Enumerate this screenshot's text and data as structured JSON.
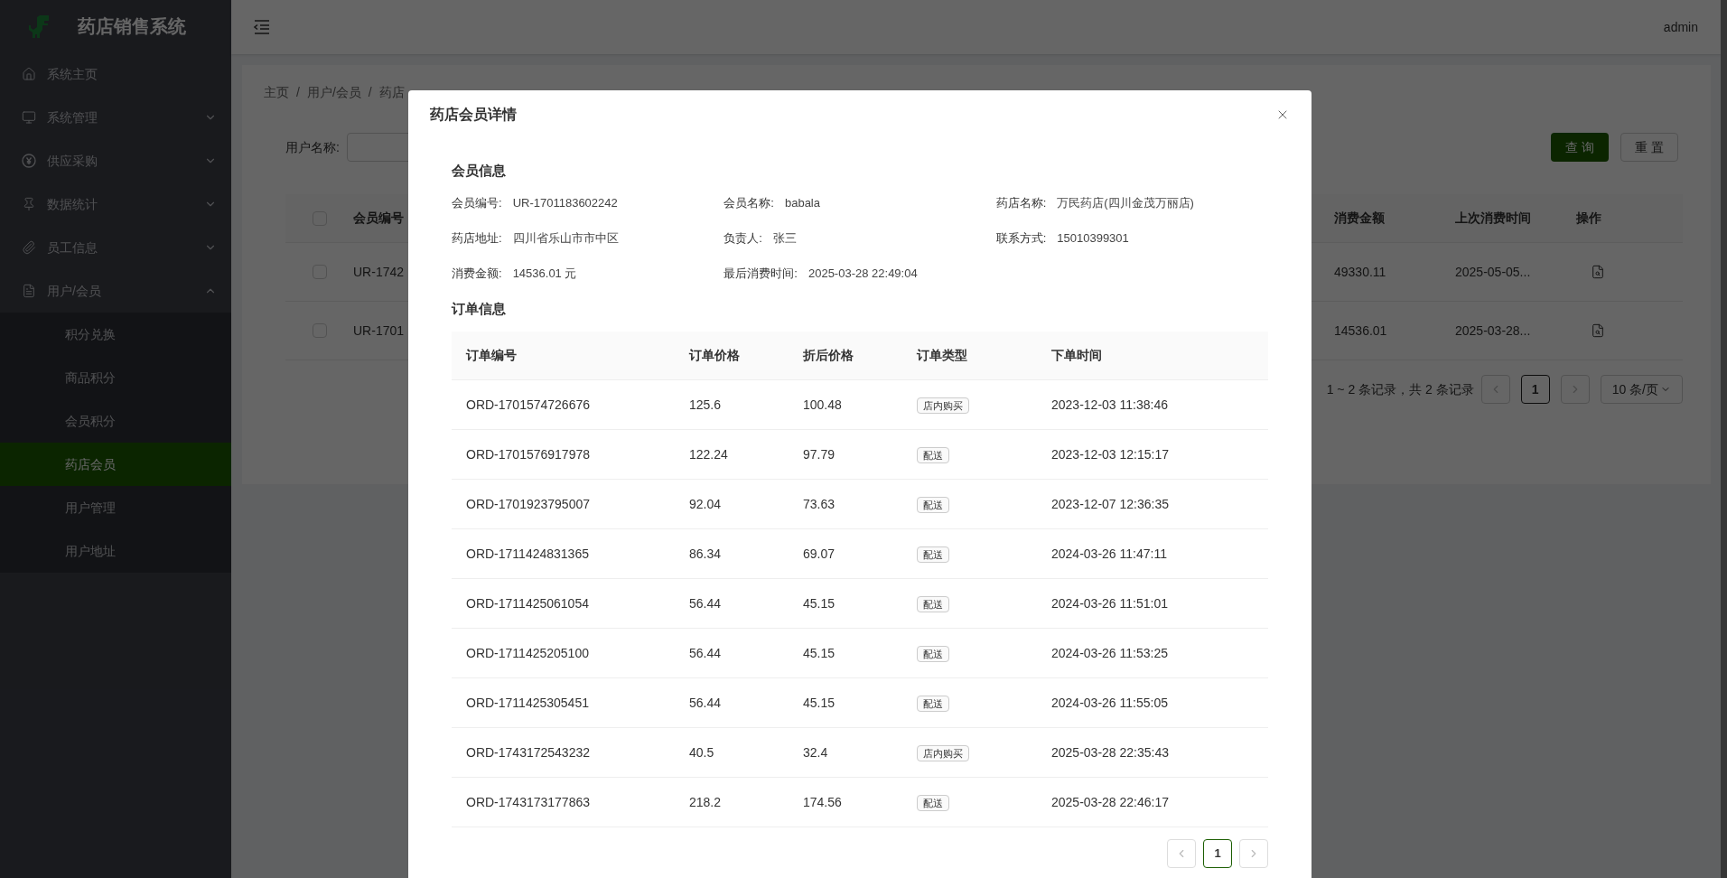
{
  "sidebar": {
    "title": "药店销售系统",
    "items": [
      {
        "label": "系统主页"
      },
      {
        "label": "系统管理",
        "expanded": false
      },
      {
        "label": "供应采购",
        "expanded": false
      },
      {
        "label": "数据统计",
        "expanded": false
      },
      {
        "label": "员工信息",
        "expanded": false
      },
      {
        "label": "用户/会员",
        "expanded": true,
        "children": [
          {
            "label": "积分兑换",
            "selected": false
          },
          {
            "label": "商品积分",
            "selected": false
          },
          {
            "label": "会员积分",
            "selected": false
          },
          {
            "label": "药店会员",
            "selected": true
          },
          {
            "label": "用户管理",
            "selected": false
          },
          {
            "label": "用户地址",
            "selected": false
          }
        ]
      }
    ]
  },
  "header": {
    "user": "admin"
  },
  "breadcrumb": [
    "主页",
    "用户/会员",
    "药店"
  ],
  "breadcrumb_separator": "/",
  "search": {
    "label": "用户名称:",
    "buttons": [
      "查 询",
      "重 置"
    ]
  },
  "member_table": {
    "columns_left": [
      "会员编号"
    ],
    "columns_right": [
      "消费金额",
      "上次消费时间",
      "操作"
    ],
    "rows": [
      {
        "id": "UR-1742",
        "amount": "49330.11",
        "last_time": "2025-05-05...",
        "checked": false
      },
      {
        "id": "UR-1701",
        "amount": "14536.01",
        "last_time": "2025-03-28...",
        "checked": false
      }
    ],
    "header_checked": false
  },
  "pagination": {
    "summary": "1 ~ 2 条记录，共 2 条记录",
    "pages": [
      {
        "label": "1",
        "selected": true
      }
    ],
    "page_size": "10 条/页"
  },
  "modal": {
    "title": "药店会员详情",
    "member_section": "会员信息",
    "fields": [
      {
        "label": "会员编号:",
        "value": "UR-1701183602242"
      },
      {
        "label": "会员名称:",
        "value": "babala"
      },
      {
        "label": "药店名称:",
        "value": "万民药店(四川金茂万丽店)"
      },
      {
        "label": "药店地址:",
        "value": "四川省乐山市市中区"
      },
      {
        "label": "负责人:",
        "value": "张三"
      },
      {
        "label": "联系方式:",
        "value": "15010399301"
      },
      {
        "label": "消费金额:",
        "value": "14536.01 元"
      },
      {
        "label": "最后消费时间:",
        "value": "2025-03-28 22:49:04"
      }
    ],
    "order_section": "订单信息",
    "order_columns": [
      "订单编号",
      "订单价格",
      "折后价格",
      "订单类型",
      "下单时间"
    ],
    "orders": [
      [
        "ORD-1701574726676",
        "125.6",
        "100.48",
        "店内购买",
        "2023-12-03 11:38:46"
      ],
      [
        "ORD-1701576917978",
        "122.24",
        "97.79",
        "配送",
        "2023-12-03 12:15:17"
      ],
      [
        "ORD-1701923795007",
        "92.04",
        "73.63",
        "配送",
        "2023-12-07 12:36:35"
      ],
      [
        "ORD-1711424831365",
        "86.34",
        "69.07",
        "配送",
        "2024-03-26 11:47:11"
      ],
      [
        "ORD-1711425061054",
        "56.44",
        "45.15",
        "配送",
        "2024-03-26 11:51:01"
      ],
      [
        "ORD-1711425205100",
        "56.44",
        "45.15",
        "配送",
        "2024-03-26 11:53:25"
      ],
      [
        "ORD-1711425305451",
        "56.44",
        "45.15",
        "配送",
        "2024-03-26 11:55:05"
      ],
      [
        "ORD-1743172543232",
        "40.5",
        "32.4",
        "店内购买",
        "2025-03-28 22:35:43"
      ],
      [
        "ORD-1743173177863",
        "218.2",
        "174.56",
        "配送",
        "2025-03-28 22:46:17"
      ]
    ],
    "pages": [
      {
        "label": "1",
        "selected": true
      }
    ]
  }
}
